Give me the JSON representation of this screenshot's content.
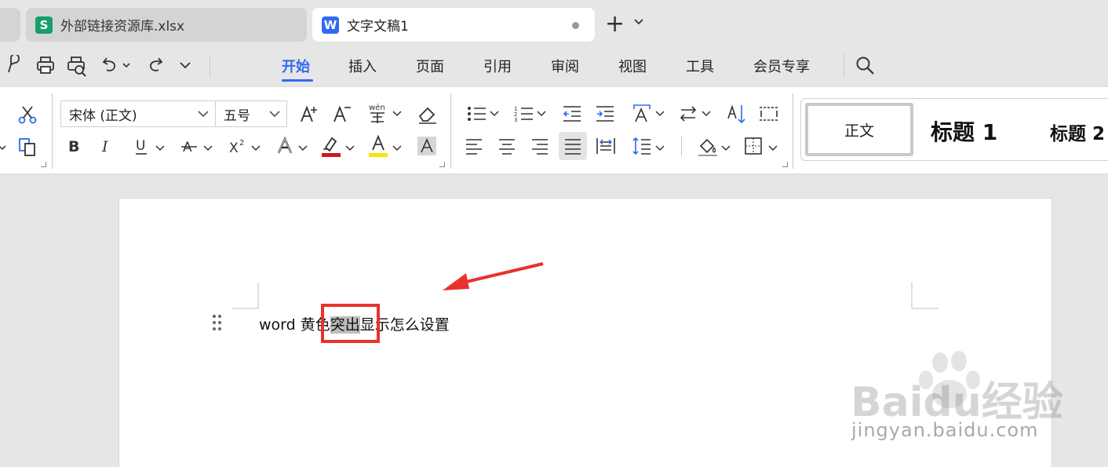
{
  "tabs": [
    {
      "label": "外部链接资源库.xlsx",
      "badge": "S",
      "state": "inactive"
    },
    {
      "label": "文字文稿1",
      "badge": "W",
      "state": "active",
      "unsaved": true
    }
  ],
  "menu": {
    "items": [
      "开始",
      "插入",
      "页面",
      "引用",
      "审阅",
      "视图",
      "工具",
      "会员专享"
    ],
    "active": "开始"
  },
  "ribbon": {
    "font_name": "宋体 (正文)",
    "font_size": "五号",
    "styles": [
      "正文",
      "标题 1",
      "标题 2"
    ]
  },
  "document": {
    "text_before": "word 黄色",
    "text_highlight": "突出",
    "text_after": "显示怎么设置"
  },
  "watermark": {
    "logo_text": "Baidu经验",
    "url": "jingyan.baidu.com"
  },
  "colors": {
    "accent": "#2f6bf0",
    "annotation_red": "#e8322d",
    "highlight_gray": "#bdbdbd",
    "font_color_swatch": "#d4161c",
    "highlight_swatch": "#f3e600"
  }
}
